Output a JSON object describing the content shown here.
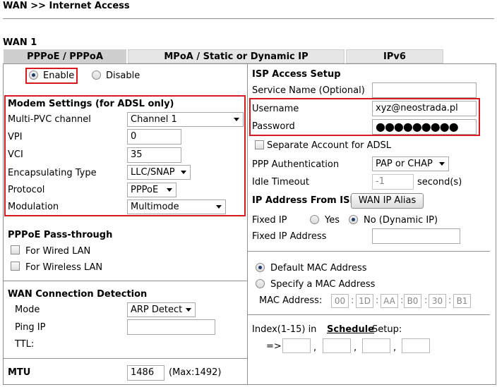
{
  "breadcrumb": "WAN >> Internet Access",
  "section_title": "WAN 1",
  "tabs": [
    "PPPoE / PPPoA",
    "MPoA / Static or Dynamic IP",
    "IPv6"
  ],
  "enable": {
    "enable_label": "Enable",
    "disable_label": "Disable",
    "selected": "Enable"
  },
  "modem": {
    "title": "Modem Settings (for ADSL only)",
    "multi_pvc_label": "Multi-PVC channel",
    "multi_pvc_value": "Channel 1",
    "vpi_label": "VPI",
    "vpi_value": "0",
    "vci_label": "VCI",
    "vci_value": "35",
    "encap_label": "Encapsulating Type",
    "encap_value": "LLC/SNAP",
    "protocol_label": "Protocol",
    "protocol_value": "PPPoE",
    "modulation_label": "Modulation",
    "modulation_value": "Multimode"
  },
  "passthrough": {
    "title": "PPPoE Pass-through",
    "wired": "For Wired LAN",
    "wireless": "For Wireless LAN"
  },
  "detection": {
    "title": "WAN Connection Detection",
    "mode_label": "Mode",
    "mode_value": "ARP Detect",
    "ping_label": "Ping IP",
    "ping_value": "",
    "ttl_label": "TTL:"
  },
  "mtu": {
    "label": "MTU",
    "value": "1486",
    "max": "(Max:1492)"
  },
  "isp": {
    "title": "ISP Access Setup",
    "service_label": "Service Name (Optional)",
    "service_value": "",
    "username_label": "Username",
    "username_value": "xyz@neostrada.pl",
    "password_label": "Password",
    "password_value": "●●●●●●●●●",
    "separate_label": "Separate Account for ADSL",
    "ppp_auth_label": "PPP Authentication",
    "ppp_auth_value": "PAP or CHAP",
    "idle_label": "Idle Timeout",
    "idle_value": "-1",
    "idle_unit": "second(s)"
  },
  "ip_from_isp": {
    "title": "IP Address From ISP",
    "alias_button": "WAN IP Alias",
    "fixed_ip_label": "Fixed IP",
    "yes_label": "Yes",
    "no_label": "No (Dynamic IP)",
    "fixed_addr_label": "Fixed IP Address",
    "fixed_addr_value": ""
  },
  "mac": {
    "default_label": "Default MAC Address",
    "specify_label": "Specify a MAC Address",
    "address_label": "MAC Address:",
    "octets": [
      "00",
      "1D",
      "AA",
      "B0",
      "30",
      "B1"
    ]
  },
  "schedule": {
    "prefix": "Index(1-15) in",
    "link": "Schedule",
    "suffix": "Setup:",
    "arrow": "=>"
  }
}
